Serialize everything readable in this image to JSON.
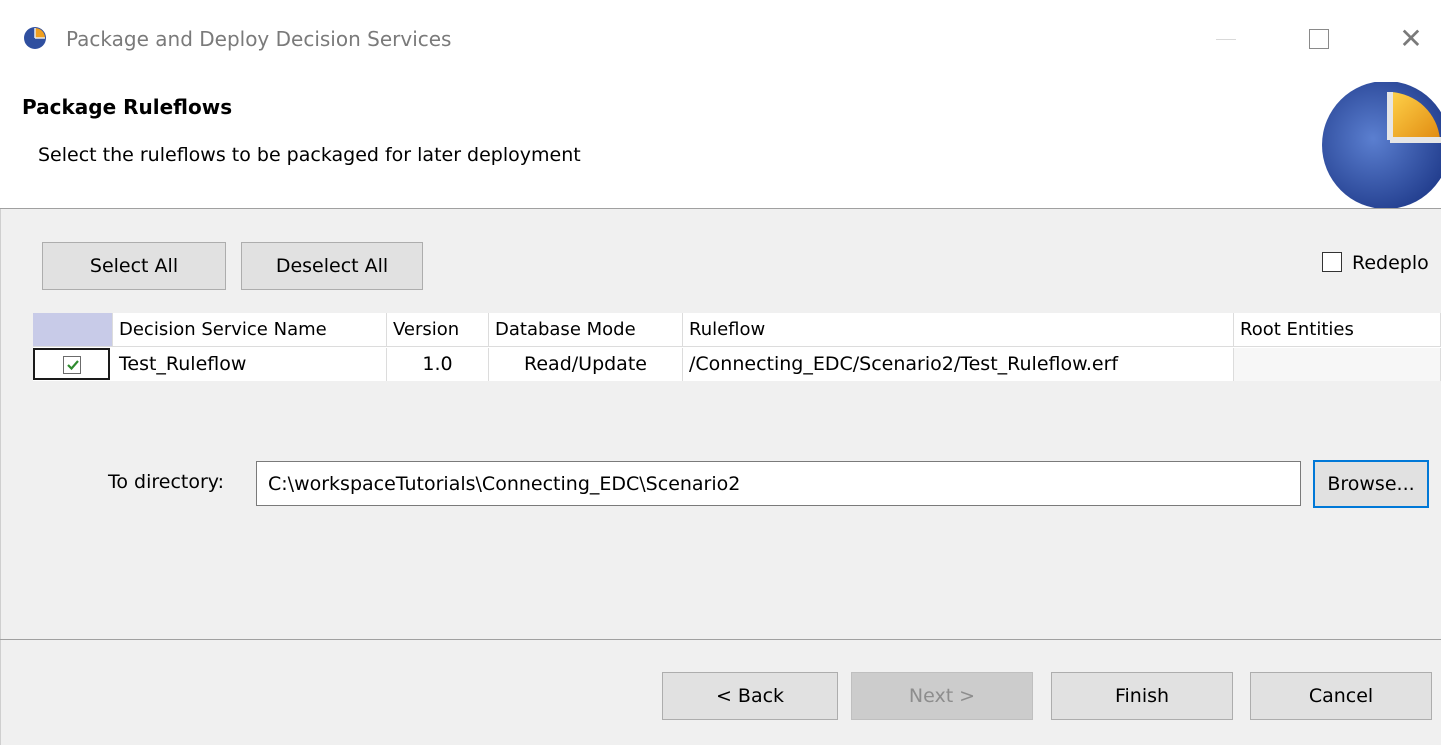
{
  "window": {
    "title": "Package and Deploy Decision Services",
    "app_icon": "pie-chart-icon",
    "controls": {
      "minimize_icon": "minimize-icon",
      "maximize_icon": "maximize-icon",
      "close_icon": "close-icon",
      "close_glyph": "✕"
    }
  },
  "header": {
    "title": "Package Ruleflows",
    "description": "Select the ruleflows to be packaged for later deployment",
    "graphic_icon": "pie-chart-icon"
  },
  "toolbar": {
    "select_all_label": "Select All",
    "deselect_all_label": "Deselect All",
    "redeploy_label": "Redeplo",
    "redeploy_checked": false
  },
  "table": {
    "columns": [
      "",
      "Decision Service Name",
      "Version",
      "Database Mode",
      "Ruleflow",
      "Root Entities"
    ],
    "rows": [
      {
        "checked": true,
        "name": "Test_Ruleflow",
        "version": "1.0",
        "database_mode": "Read/Update",
        "ruleflow": "/Connecting_EDC/Scenario2/Test_Ruleflow.erf",
        "root_entities": ""
      }
    ]
  },
  "directory": {
    "label": "To directory:",
    "value": "C:\\workspaceTutorials\\Connecting_EDC\\Scenario2",
    "browse_label": "Browse..."
  },
  "footer": {
    "back_label": "< Back",
    "next_label": "Next >",
    "next_enabled": false,
    "finish_label": "Finish",
    "cancel_label": "Cancel"
  },
  "colors": {
    "accent": "#0078d7",
    "check_green": "#2e8b2e",
    "selection_header": "#c8cbe8",
    "icon_blue": "#2f4f9f",
    "icon_orange": "#f0a020"
  }
}
